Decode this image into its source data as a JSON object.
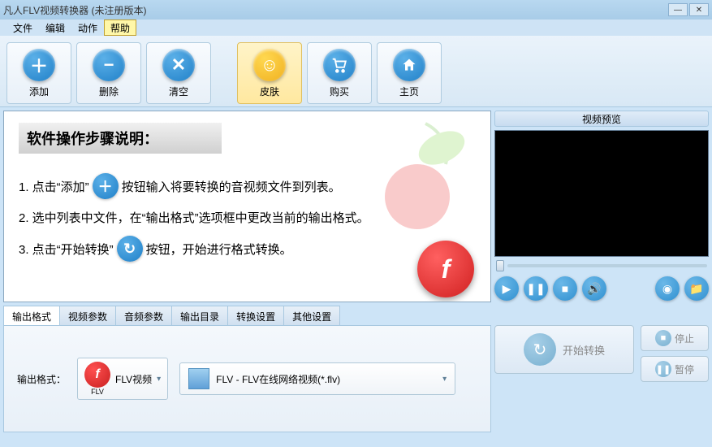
{
  "window": {
    "title": "凡人FLV视频转换器  (未注册版本)"
  },
  "menu": {
    "file": "文件",
    "edit": "编辑",
    "action": "动作",
    "help": "帮助"
  },
  "toolbar": {
    "add": "添加",
    "remove": "删除",
    "clear": "清空",
    "skin": "皮肤",
    "buy": "购买",
    "home": "主页"
  },
  "guide": {
    "header": "软件操作步骤说明：",
    "step1a": "1. 点击“添加”",
    "step1b": "按钮输入将要转换的音视频文件到列表。",
    "step2": "2. 选中列表中文件，在“输出格式”选项框中更改当前的输出格式。",
    "step3a": "3. 点击“开始转换”",
    "step3b": "按钮，开始进行格式转换。"
  },
  "preview": {
    "title": "视频预览"
  },
  "tabs": {
    "output_format": "输出格式",
    "video_params": "视频参数",
    "audio_params": "音频参数",
    "output_dir": "输出目录",
    "convert_settings": "转换设置",
    "other_settings": "其他设置"
  },
  "output": {
    "label": "输出格式：",
    "chip_text": "FLV视频",
    "chip_sub": "FLV",
    "select_text": "FLV - FLV在线网络视频(*.flv)"
  },
  "actions": {
    "start": "开始转换",
    "stop": "停止",
    "pause": "暂停"
  }
}
